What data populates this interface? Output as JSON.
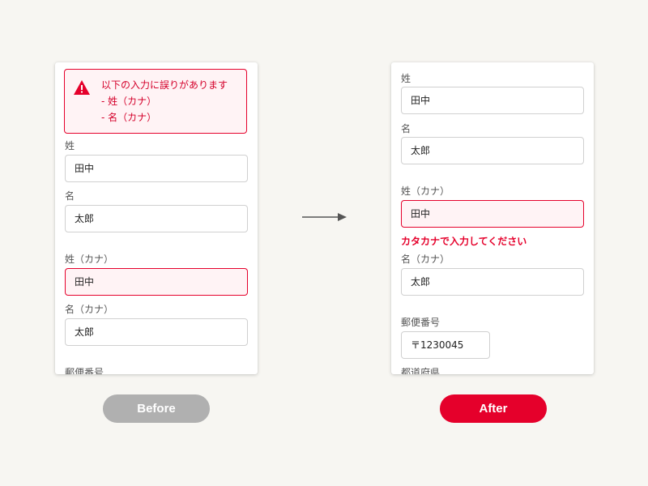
{
  "colors": {
    "accent": "#e5002b",
    "background": "#f7f6f2",
    "before_pill": "#b0b0b0"
  },
  "before": {
    "alert": {
      "icon": "warning-icon",
      "title": "以下の入力に誤りがあります",
      "items": [
        "- 姓（カナ）",
        "- 名（カナ）"
      ]
    },
    "fields": [
      {
        "label": "姓",
        "value": "田中"
      },
      {
        "label": "名",
        "value": "太郎"
      },
      {
        "label": "姓（カナ）",
        "value": "田中"
      },
      {
        "label": "名（カナ）",
        "value": "太郎"
      }
    ],
    "cut_label": "郵便番号",
    "pill": "Before"
  },
  "after": {
    "fields": [
      {
        "label": "姓",
        "value": "田中"
      },
      {
        "label": "名",
        "value": "太郎"
      },
      {
        "label": "姓（カナ）",
        "value": "田中"
      },
      {
        "label": "名（カナ）",
        "value": "太郎"
      },
      {
        "label": "郵便番号",
        "value": "〒1230045"
      }
    ],
    "error_message": "カタカナで入力してください",
    "cut_label": "都道府県",
    "pill": "After"
  },
  "arrow_icon": "arrow-right-icon"
}
